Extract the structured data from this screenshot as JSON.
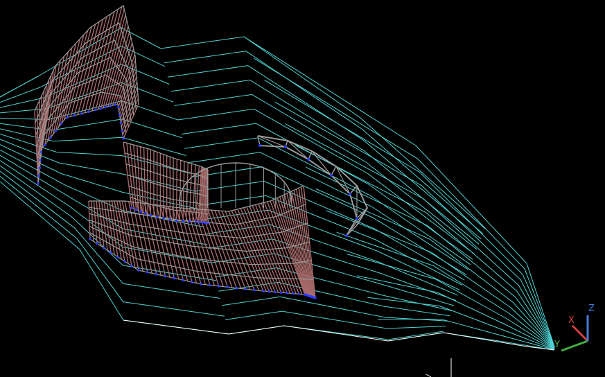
{
  "viewport": {
    "background": "#000000",
    "colors": {
      "terrain_contours": "#4fd3d3",
      "terrain_edge": "#ffffff",
      "structure_frame": "#9a9a9a",
      "structure_members": "#a86a6a",
      "support_nodes": "#2a3cff",
      "axis_x": "#d64040",
      "axis_y": "#3fb03f",
      "axis_z": "#4a78d8"
    }
  },
  "ucs_icon": {
    "x_label": "X",
    "y_label": "Y",
    "z_label": "Z"
  }
}
